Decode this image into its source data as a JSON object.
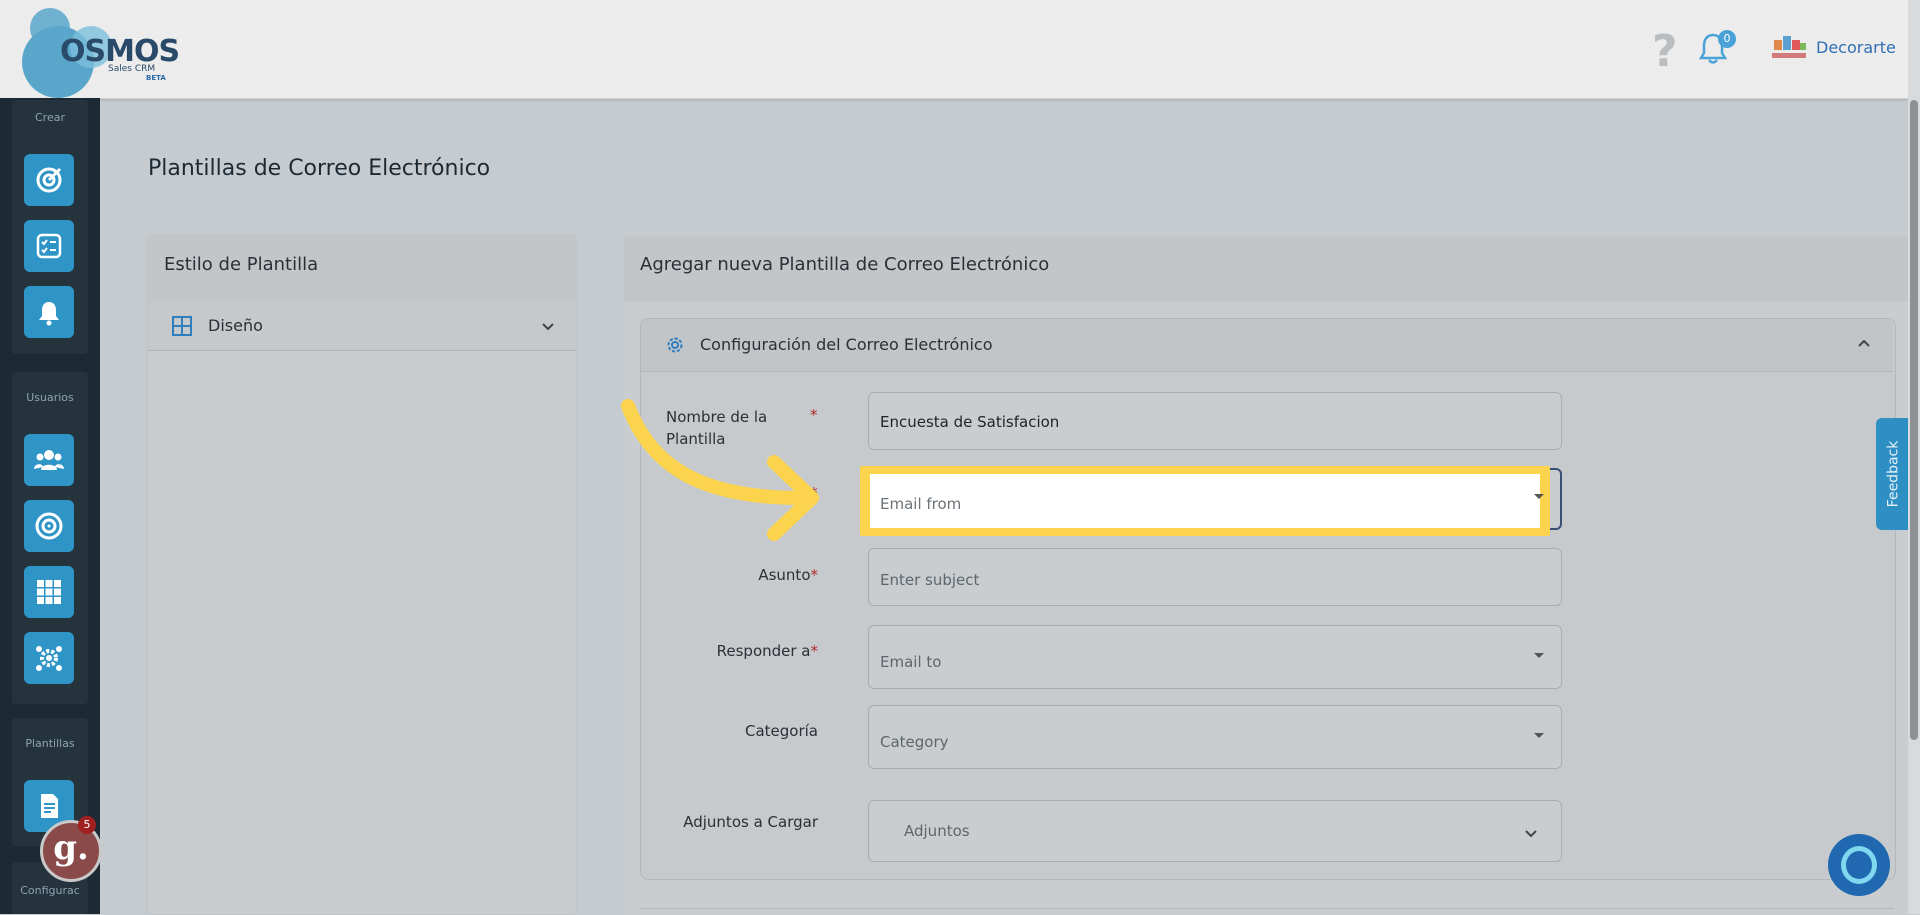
{
  "header": {
    "logo_text": "OSMOS",
    "logo_sub": "Sales CRM",
    "logo_beta": "BETA",
    "help_symbol": "?",
    "notification_count": "0",
    "company_name": "Decorarte"
  },
  "sidebar": {
    "groups": [
      {
        "label": "Crear",
        "buttons": [
          "target-icon",
          "checklist-icon",
          "alarm-icon"
        ]
      },
      {
        "label": "Usuarios",
        "buttons": [
          "users-icon",
          "bullseye-icon",
          "apps-grid-icon",
          "team-gear-icon"
        ]
      },
      {
        "label": "Plantillas",
        "buttons": [
          "document-icon"
        ]
      },
      {
        "label": "Configurac",
        "buttons": []
      }
    ],
    "g_letter": "g.",
    "g_count": "5"
  },
  "page": {
    "title": "Plantillas de Correo Electrónico"
  },
  "left_card": {
    "title": "Estilo de Plantilla",
    "item_label": "Diseño"
  },
  "right_card": {
    "title": "Agregar nueva Plantilla de Correo Electrónico",
    "section_title": "Configuración del Correo Electrónico",
    "fields": {
      "template_name": {
        "label": "Nombre de la Plantilla",
        "value": "Encuesta de Satisfacion"
      },
      "email_from": {
        "placeholder": "Email from"
      },
      "subject": {
        "label": "Asunto",
        "placeholder": "Enter subject"
      },
      "reply_to": {
        "label": "Responder a",
        "placeholder": "Email to"
      },
      "category": {
        "label": "Categoría",
        "placeholder": "Category"
      },
      "attachments": {
        "label": "Adjuntos a Cargar",
        "placeholder": "Adjuntos"
      }
    },
    "required_mark": "*"
  },
  "feedback_label": "Feedback",
  "colors": {
    "accent": "#2f95c7",
    "highlight": "#fcd34d",
    "sidebar_bg": "#1d2a33",
    "required": "#b22a2a"
  }
}
